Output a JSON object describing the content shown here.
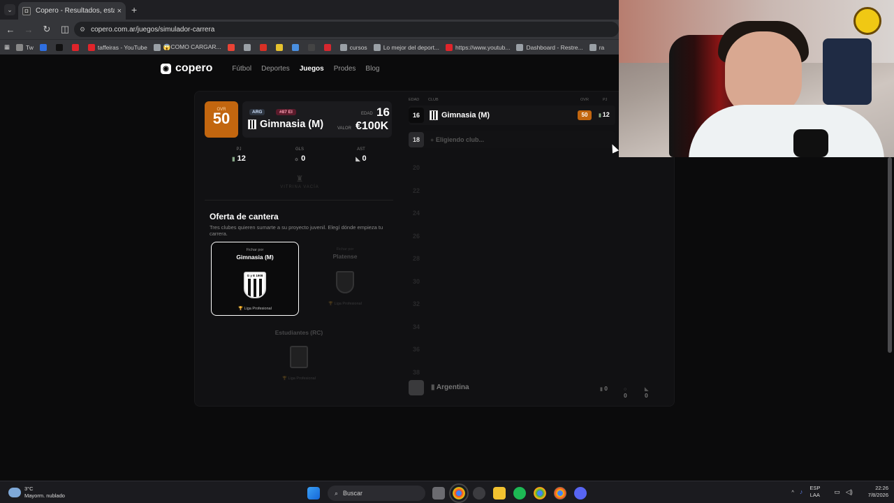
{
  "browser": {
    "tab_title": "Copero - Resultados, estadístic",
    "tab_icon": "copero-favicon",
    "new_tab": "+",
    "close": "×",
    "url": "copero.com.ar/juegos/simulador-carrera",
    "bookmarks": [
      {
        "label": "Tw",
        "color": "#888888"
      },
      {
        "label": "",
        "color": "#2f6fe0"
      },
      {
        "label": "",
        "color": "#111111"
      },
      {
        "label": "",
        "color": "#e0242a"
      },
      {
        "label": "taffeiras - YouTube",
        "color": "#e0242a"
      },
      {
        "label": "😱COMO CARGAR...",
        "color": "#9aa0a6"
      },
      {
        "label": "",
        "color": "#ea4335"
      },
      {
        "label": "",
        "color": "#9aa0a6"
      },
      {
        "label": "",
        "color": "#d93025"
      },
      {
        "label": "",
        "color": "#e6c22e"
      },
      {
        "label": "",
        "color": "#4a8fe0"
      },
      {
        "label": "",
        "color": "#444444"
      },
      {
        "label": "",
        "color": "#d7272f"
      },
      {
        "label": "cursos",
        "color": "#9aa0a6"
      },
      {
        "label": "Lo mejor del deport...",
        "color": "#9aa0a6"
      },
      {
        "label": "https://www.youtub...",
        "color": "#e0242a"
      },
      {
        "label": "Dashboard - Restre...",
        "color": "#9aa0a6"
      },
      {
        "label": "ra",
        "color": "#9aa0a6"
      }
    ]
  },
  "site": {
    "logo": "copero",
    "nav": [
      "Fútbol",
      "Deportes",
      "Juegos",
      "Prodes",
      "Blog"
    ],
    "active_nav": "Juegos"
  },
  "player": {
    "ovr_label": "OVR",
    "ovr": "50",
    "nation": "ARG",
    "rank": "#87 EI",
    "club": "Gimnasia (M)",
    "age_label": "EDAD",
    "age": "16",
    "value_label": "VALOR",
    "value": "€100K",
    "stats": [
      {
        "label": "PJ",
        "value": "12",
        "icon": "shirt-icon"
      },
      {
        "label": "GLS",
        "value": "0",
        "icon": "ball-icon"
      },
      {
        "label": "AST",
        "value": "0",
        "icon": "boot-icon"
      }
    ],
    "trophy_case": "VITRINA VACÍA"
  },
  "offer": {
    "title": "Oferta de cantera",
    "subtitle": "Tres clubes quieren sumarte a su proyecto juvenil. Elegí dónde empieza tu carrera.",
    "clubs": [
      {
        "prefix": "Fichar por",
        "name": "Gimnasia (M)",
        "crest_text": "G y E 1908",
        "league": "Liga Profesional",
        "selected": true
      },
      {
        "prefix": "Fichar por",
        "name": "Platense",
        "crest_text": "",
        "league": "Liga Profesional",
        "selected": false
      },
      {
        "prefix": "",
        "name": "Estudiantes (RC)",
        "crest_text": "",
        "league": "Liga Profesional",
        "selected": false
      }
    ]
  },
  "timeline": {
    "headers": {
      "age": "EDAD",
      "club": "CLUB",
      "ovr": "OVR",
      "pj": "PJ"
    },
    "row_current": {
      "age": "16",
      "club": "Gimnasia (M)",
      "ovr": "50",
      "pj": "12"
    },
    "row_pending": {
      "age": "18",
      "club": "Eligiendo club..."
    },
    "future_ages": [
      "20",
      "22",
      "24",
      "26",
      "28",
      "30",
      "32",
      "34",
      "36",
      "38"
    ],
    "footer": {
      "country": "Argentina",
      "pj": "0",
      "goals": "0",
      "assists": "0"
    }
  },
  "taskbar": {
    "weather_temp": "3°C",
    "weather_desc": "Mayorm. nublado",
    "search": "Buscar",
    "lang_top": "ESP",
    "lang_bottom": "LAA",
    "time": "22:26",
    "date": "7/8/2026"
  },
  "colors": {
    "accent": "#c2660f",
    "rank_tag": "#5a1b2b"
  }
}
